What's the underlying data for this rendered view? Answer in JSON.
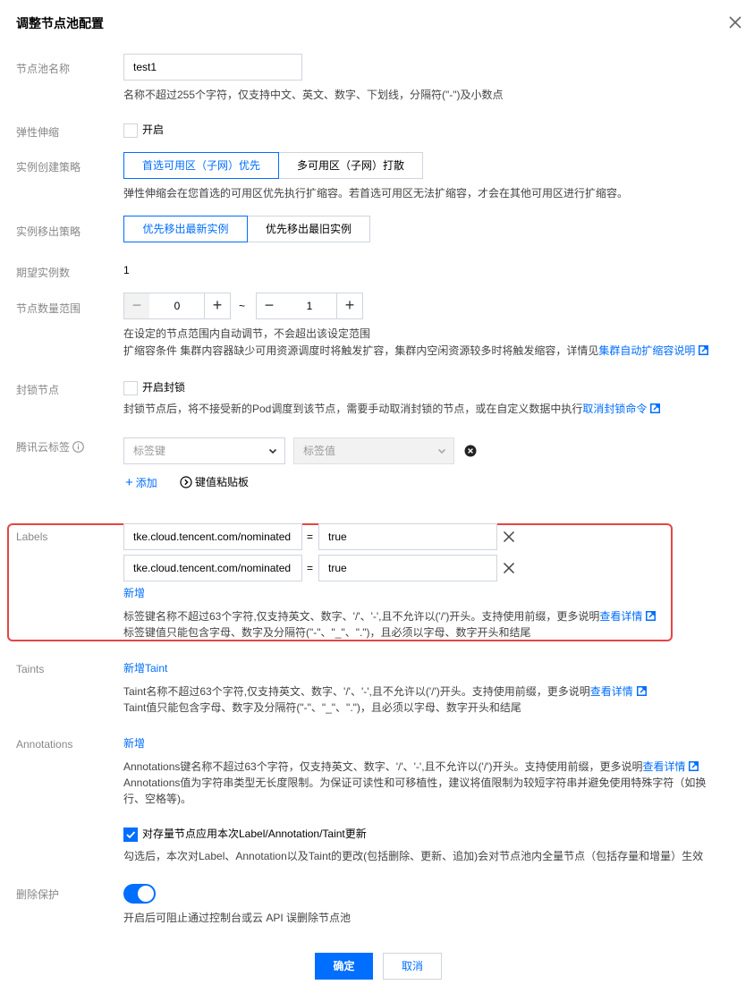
{
  "dialog": {
    "title": "调整节点池配置",
    "confirm_label": "确定",
    "cancel_label": "取消"
  },
  "pool_name": {
    "label": "节点池名称",
    "value": "test1",
    "hint": "名称不超过255个字符，仅支持中文、英文、数字、下划线，分隔符(\"-\")及小数点"
  },
  "autoscale": {
    "label": "弹性伸缩",
    "checkbox_label": "开启",
    "checked": false
  },
  "create_policy": {
    "label": "实例创建策略",
    "options": [
      "首选可用区（子网）优先",
      "多可用区（子网）打散"
    ],
    "selected": "首选可用区（子网）优先",
    "hint": "弹性伸缩会在您首选的可用区优先执行扩缩容。若首选可用区无法扩缩容，才会在其他可用区进行扩缩容。"
  },
  "remove_policy": {
    "label": "实例移出策略",
    "options": [
      "优先移出最新实例",
      "优先移出最旧实例"
    ],
    "selected": "优先移出最新实例"
  },
  "desired": {
    "label": "期望实例数",
    "value": "1"
  },
  "range": {
    "label": "节点数量范围",
    "min": "0",
    "max": "1",
    "separator": "~",
    "hint1": "在设定的节点范围内自动调节，不会超出该设定范围",
    "hint2_prefix": "扩缩容条件 集群内容器缺少可用资源调度时将触发扩容，集群内空闲资源较多时将触发缩容，详情见",
    "hint2_link": "集群自动扩缩容说明"
  },
  "cordon": {
    "label": "封锁节点",
    "checkbox_label": "开启封锁",
    "checked": false,
    "hint_prefix": "封锁节点后，将不接受新的Pod调度到该节点，需要手动取消封锁的节点，或在自定义数据中执行",
    "hint_link": "取消封锁命令"
  },
  "cloud_tags": {
    "label": "腾讯云标签",
    "key_placeholder": "标签键",
    "value_placeholder": "标签值",
    "add_label": "添加",
    "paste_label": "键值粘贴板"
  },
  "labels": {
    "label": "Labels",
    "rows": [
      {
        "key": "tke.cloud.tencent.com/nominated",
        "eq": "=",
        "value": "true"
      },
      {
        "key": "tke.cloud.tencent.com/nominated",
        "eq": "=",
        "value": "true"
      }
    ],
    "add_label": "新增",
    "hint1_prefix": "标签键名称不超过63个字符,仅支持英文、数字、'/'、'-',且不允许以('/')开头。支持使用前缀，更多说明",
    "hint1_link": "查看详情",
    "hint2": "标签键值只能包含字母、数字及分隔符(\"-\"、\"_\"、\".\")，且必须以字母、数字开头和结尾"
  },
  "taints": {
    "label": "Taints",
    "add_label": "新增Taint",
    "hint1_prefix": "Taint名称不超过63个字符,仅支持英文、数字、'/'、'-',且不允许以('/')开头。支持使用前缀，更多说明",
    "hint1_link": "查看详情",
    "hint2": "Taint值只能包含字母、数字及分隔符(\"-\"、\"_\"、\".\")，且必须以字母、数字开头和结尾"
  },
  "annotations": {
    "label": "Annotations",
    "add_label": "新增",
    "hint1_prefix": "Annotations键名称不超过63个字符，仅支持英文、数字、'/'、'-',且不允许以('/')开头。支持使用前缀，更多说明",
    "hint1_link": "查看详情",
    "hint2": "Annotations值为字符串类型无长度限制。为保证可读性和可移植性，建议将值限制为较短字符串并避免使用特殊字符（如换",
    "hint3": "行、空格等)。"
  },
  "apply_existing": {
    "checkbox_label": "对存量节点应用本次Label/Annotation/Taint更新",
    "checked": true,
    "hint": "勾选后，本次对Label、Annotation以及Taint的更改(包括删除、更新、追加)会对节点池内全量节点（包括存量和增量）生效"
  },
  "delete_protection": {
    "label": "删除保护",
    "enabled": true,
    "hint": "开启后可阻止通过控制台或云 API 误删除节点池"
  },
  "colors": {
    "primary": "#006eff",
    "highlight_border": "#e54545"
  }
}
